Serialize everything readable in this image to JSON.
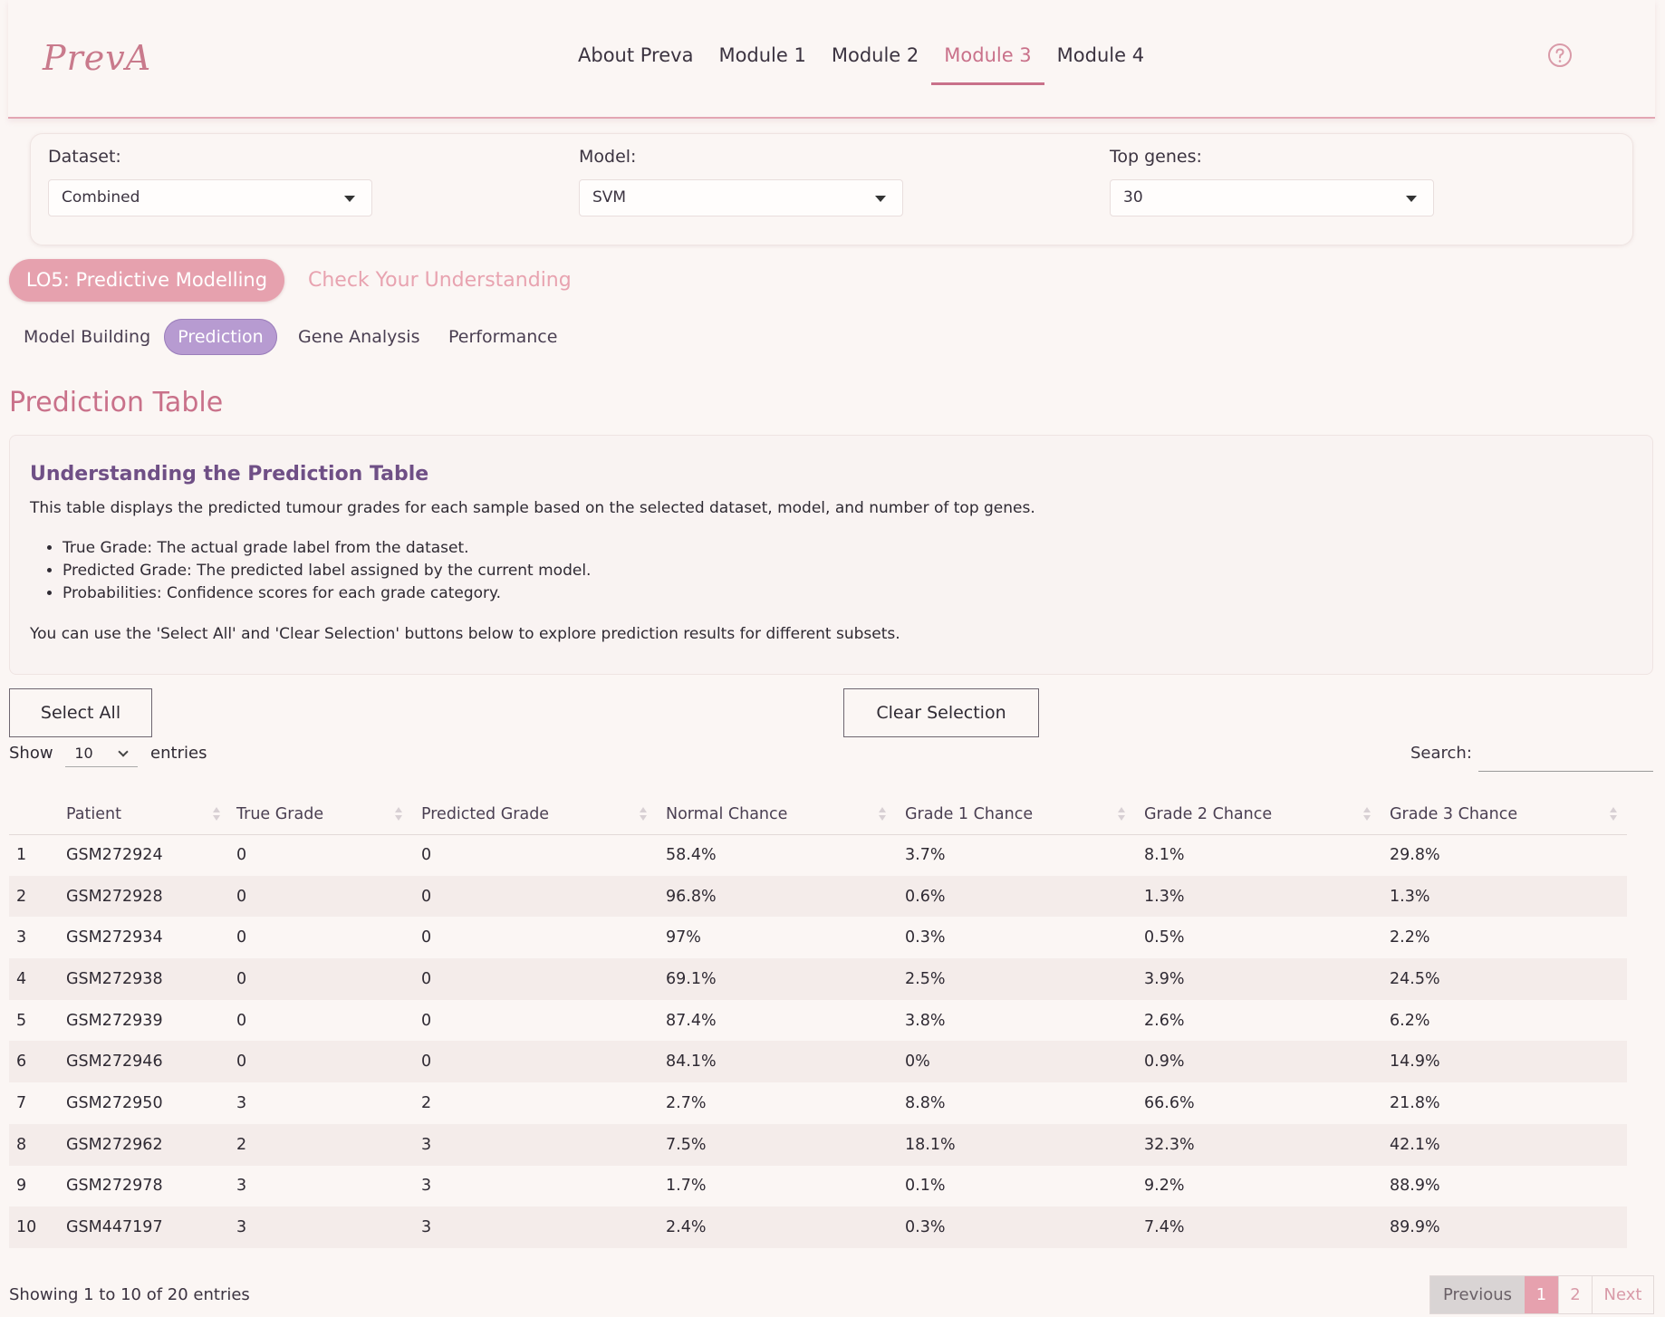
{
  "nav": {
    "logo": "PrevA",
    "links": [
      {
        "label": "About Preva"
      },
      {
        "label": "Module 1"
      },
      {
        "label": "Module 2"
      },
      {
        "label": "Module 3"
      },
      {
        "label": "Module 4"
      }
    ],
    "active": "Module 3",
    "help_icon": "question-circle-icon"
  },
  "controls": {
    "dataset": {
      "label": "Dataset:",
      "value": "Combined"
    },
    "model": {
      "label": "Model:",
      "value": "SVM"
    },
    "top_genes": {
      "label": "Top genes:",
      "value": "30"
    }
  },
  "section_tabs": {
    "active": "LO5: Predictive Modelling",
    "other": "Check Your Understanding"
  },
  "sub_tabs": [
    {
      "label": "Model Building"
    },
    {
      "label": "Prediction"
    },
    {
      "label": "Gene Analysis"
    },
    {
      "label": "Performance"
    }
  ],
  "page_title": "Prediction Table",
  "info": {
    "title": "Understanding the Prediction Table",
    "intro": "This table displays the predicted tumour grades for each sample based on the selected dataset, model, and number of top genes.",
    "bullets": [
      "True Grade: The actual grade label from the dataset.",
      "Predicted Grade: The predicted label assigned by the current model.",
      "Probabilities: Confidence scores for each grade category."
    ],
    "footer": "You can use the 'Select All' and 'Clear Selection' buttons below to explore prediction results for different subsets."
  },
  "buttons": {
    "select_all": "Select All",
    "clear_selection": "Clear Selection"
  },
  "table_controls": {
    "show_label": "Show",
    "entries_value": "10",
    "entries_label": "entries",
    "search_label": "Search:"
  },
  "table": {
    "headers": [
      "",
      "Patient",
      "True Grade",
      "Predicted Grade",
      "Normal Chance",
      "Grade 1 Chance",
      "Grade 2 Chance",
      "Grade 3 Chance"
    ],
    "rows": [
      [
        "1",
        "GSM272924",
        "0",
        "0",
        "58.4%",
        "3.7%",
        "8.1%",
        "29.8%"
      ],
      [
        "2",
        "GSM272928",
        "0",
        "0",
        "96.8%",
        "0.6%",
        "1.3%",
        "1.3%"
      ],
      [
        "3",
        "GSM272934",
        "0",
        "0",
        "97%",
        "0.3%",
        "0.5%",
        "2.2%"
      ],
      [
        "4",
        "GSM272938",
        "0",
        "0",
        "69.1%",
        "2.5%",
        "3.9%",
        "24.5%"
      ],
      [
        "5",
        "GSM272939",
        "0",
        "0",
        "87.4%",
        "3.8%",
        "2.6%",
        "6.2%"
      ],
      [
        "6",
        "GSM272946",
        "0",
        "0",
        "84.1%",
        "0%",
        "0.9%",
        "14.9%"
      ],
      [
        "7",
        "GSM272950",
        "3",
        "2",
        "2.7%",
        "8.8%",
        "66.6%",
        "21.8%"
      ],
      [
        "8",
        "GSM272962",
        "2",
        "3",
        "7.5%",
        "18.1%",
        "32.3%",
        "42.1%"
      ],
      [
        "9",
        "GSM272978",
        "3",
        "3",
        "1.7%",
        "0.1%",
        "9.2%",
        "88.9%"
      ],
      [
        "10",
        "GSM447197",
        "3",
        "3",
        "2.4%",
        "0.3%",
        "7.4%",
        "89.9%"
      ]
    ]
  },
  "footer": {
    "showing": "Showing 1 to 10 of 20 entries",
    "previous": "Previous",
    "pages": [
      "1",
      "2"
    ],
    "current_page": "1",
    "next": "Next"
  },
  "colors": {
    "accent": "#c9718a",
    "pill": "#e6a1ae",
    "subtab_active": "#b79bd1",
    "heading_purple": "#6f4f86"
  }
}
